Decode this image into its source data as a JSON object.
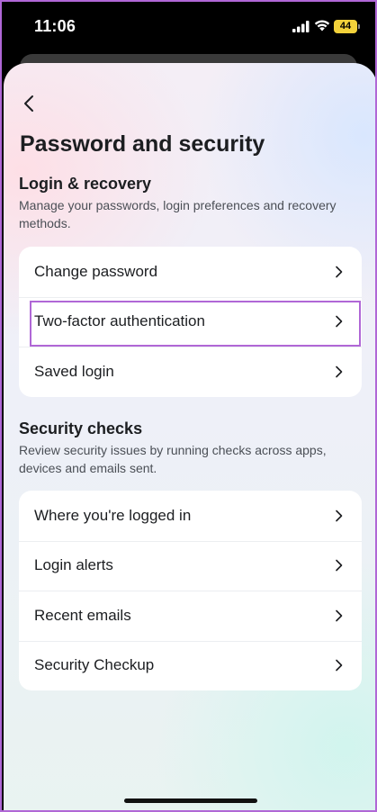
{
  "status_bar": {
    "time": "11:06",
    "battery": "44"
  },
  "page": {
    "title": "Password and security"
  },
  "login_recovery": {
    "heading": "Login & recovery",
    "description": "Manage your passwords, login preferences and recovery methods.",
    "items": [
      {
        "label": "Change password"
      },
      {
        "label": "Two-factor authentication"
      },
      {
        "label": "Saved login"
      }
    ]
  },
  "security_checks": {
    "heading": "Security checks",
    "description": "Review security issues by running checks across apps, devices and emails sent.",
    "items": [
      {
        "label": "Where you're logged in"
      },
      {
        "label": "Login alerts"
      },
      {
        "label": "Recent emails"
      },
      {
        "label": "Security Checkup"
      }
    ]
  },
  "icons": {
    "back": "chevron-left-icon",
    "row_action": "chevron-right-icon",
    "signal": "cellular-signal-icon",
    "wifi": "wifi-icon",
    "battery": "battery-icon"
  },
  "colors": {
    "highlight_border": "#b067d6",
    "battery": "#f2d13a"
  }
}
